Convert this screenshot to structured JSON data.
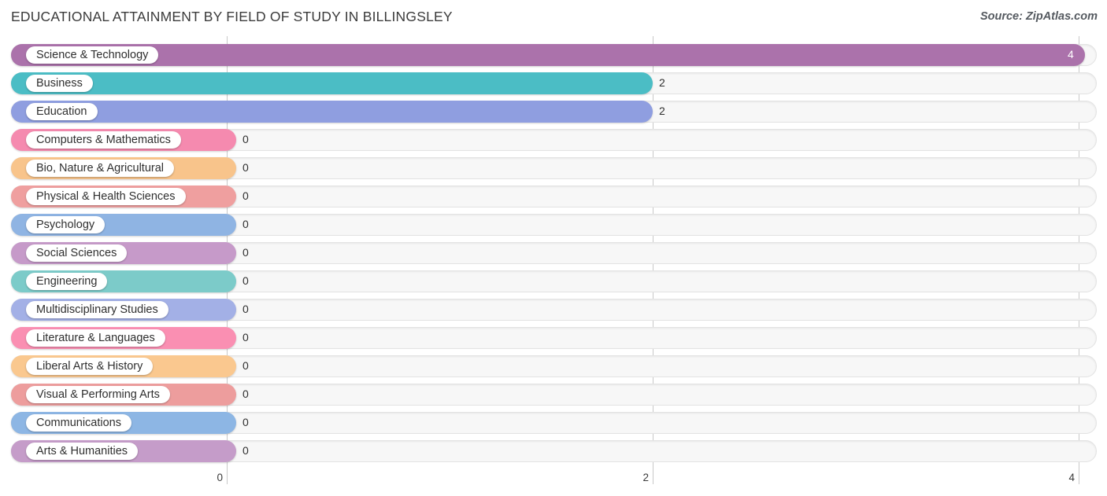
{
  "header": {
    "title": "EDUCATIONAL ATTAINMENT BY FIELD OF STUDY IN BILLINGSLEY",
    "source": "Source: ZipAtlas.com"
  },
  "chart_data": {
    "type": "bar",
    "orientation": "horizontal",
    "title": "EDUCATIONAL ATTAINMENT BY FIELD OF STUDY IN BILLINGSLEY",
    "xlabel": "",
    "ylabel": "",
    "xlim": [
      0,
      4
    ],
    "grid": true,
    "legend": "none",
    "xticks": [
      "0",
      "2",
      "4"
    ],
    "xtick_values": [
      0,
      2,
      4
    ],
    "categories": [
      "Science & Technology",
      "Business",
      "Education",
      "Computers & Mathematics",
      "Bio, Nature & Agricultural",
      "Physical & Health Sciences",
      "Psychology",
      "Social Sciences",
      "Engineering",
      "Multidisciplinary Studies",
      "Literature & Languages",
      "Liberal Arts & History",
      "Visual & Performing Arts",
      "Communications",
      "Arts & Humanities"
    ],
    "values": [
      4,
      2,
      2,
      0,
      0,
      0,
      0,
      0,
      0,
      0,
      0,
      0,
      0,
      0,
      0
    ],
    "value_labels": [
      "4",
      "2",
      "2",
      "0",
      "0",
      "0",
      "0",
      "0",
      "0",
      "0",
      "0",
      "0",
      "0",
      "0",
      "0"
    ],
    "colors": [
      "#ab72ab",
      "#4bbdc5",
      "#8f9ee0",
      "#f58aaf",
      "#f8c48b",
      "#ef9f9f",
      "#8fb4e3",
      "#c69ac9",
      "#7ccbc9",
      "#a3b0e6",
      "#fa8fb2",
      "#fac88f",
      "#ed9d9d",
      "#8db6e4",
      "#c59cc9"
    ]
  }
}
